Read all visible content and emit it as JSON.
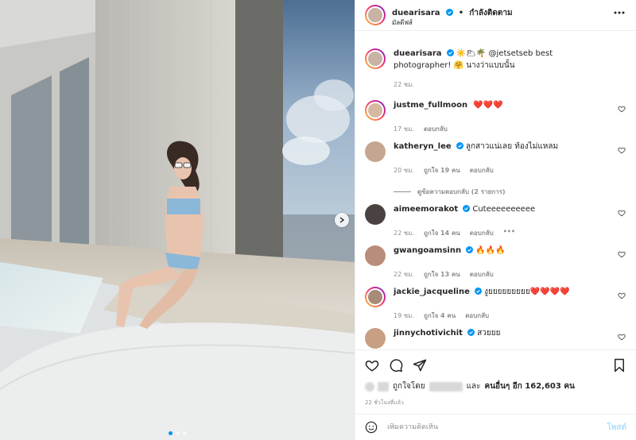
{
  "post": {
    "username": "duearisara",
    "separator": "•",
    "follow_label": "กำลังติดตาม",
    "subtitle": "มัลดีฟส์"
  },
  "caption": {
    "username": "duearisara",
    "text": "☀️🌥🌴 @jetsetseb best photographer! 🤗 นางว่าแบบนั้น",
    "time": "22 ชม."
  },
  "comments": [
    {
      "username": "justme_fullmoon",
      "verified": false,
      "text": "❤️❤️❤️",
      "time": "17 ชม.",
      "likes": "",
      "reply": "ตอบกลับ"
    },
    {
      "username": "katheryn_lee",
      "verified": true,
      "text": "ลูกสาวแน่เลย ท้องไม่แหลม",
      "time": "20 ชม.",
      "likes": "ถูกใจ 19 คน",
      "reply": "ตอบกลับ",
      "view_replies": "ดูข้อความตอบกลับ (2 รายการ)"
    },
    {
      "username": "aimeemorakot",
      "verified": true,
      "text": "Cuteeeeeeeeee",
      "time": "22 ชม.",
      "likes": "ถูกใจ 14 คน",
      "reply": "ตอบกลับ",
      "more": "•••"
    },
    {
      "username": "gwangoamsinn",
      "verified": true,
      "text": "🔥🔥🔥",
      "time": "22 ชม.",
      "likes": "ถูกใจ 13 คน",
      "reply": "ตอบกลับ"
    },
    {
      "username": "jackie_jacqueline",
      "verified": true,
      "text": "งูยยยยยยยยย❤️❤️❤️❤️",
      "time": "19 ชม.",
      "likes": "ถูกใจ 4 คน",
      "reply": "ตอบกลับ"
    },
    {
      "username": "jinnychotivichit",
      "verified": true,
      "text": "สวยยย",
      "time": "",
      "likes": "",
      "reply": ""
    }
  ],
  "likes_line": {
    "prefix": "ถูกใจโดย",
    "middle": "และ",
    "others": "คนอื่นๆ อีก 162,603 คน"
  },
  "time_ago": "22 ชั่วโมงที่แล้ว",
  "comment_input": {
    "placeholder": "เพิ่มความคิดเห็น",
    "post_label": "โพสต์"
  },
  "colors": {
    "verified": "#0095f6",
    "link": "#00376b",
    "heart": "#ed4956",
    "post_disabled": "#b2dffc"
  },
  "icons": [
    "more-icon",
    "heart-icon",
    "comment-icon",
    "share-icon",
    "save-icon",
    "emoji-icon",
    "verified-icon",
    "next-arrow-icon"
  ],
  "carousel": {
    "slides": 3,
    "active": 1
  }
}
